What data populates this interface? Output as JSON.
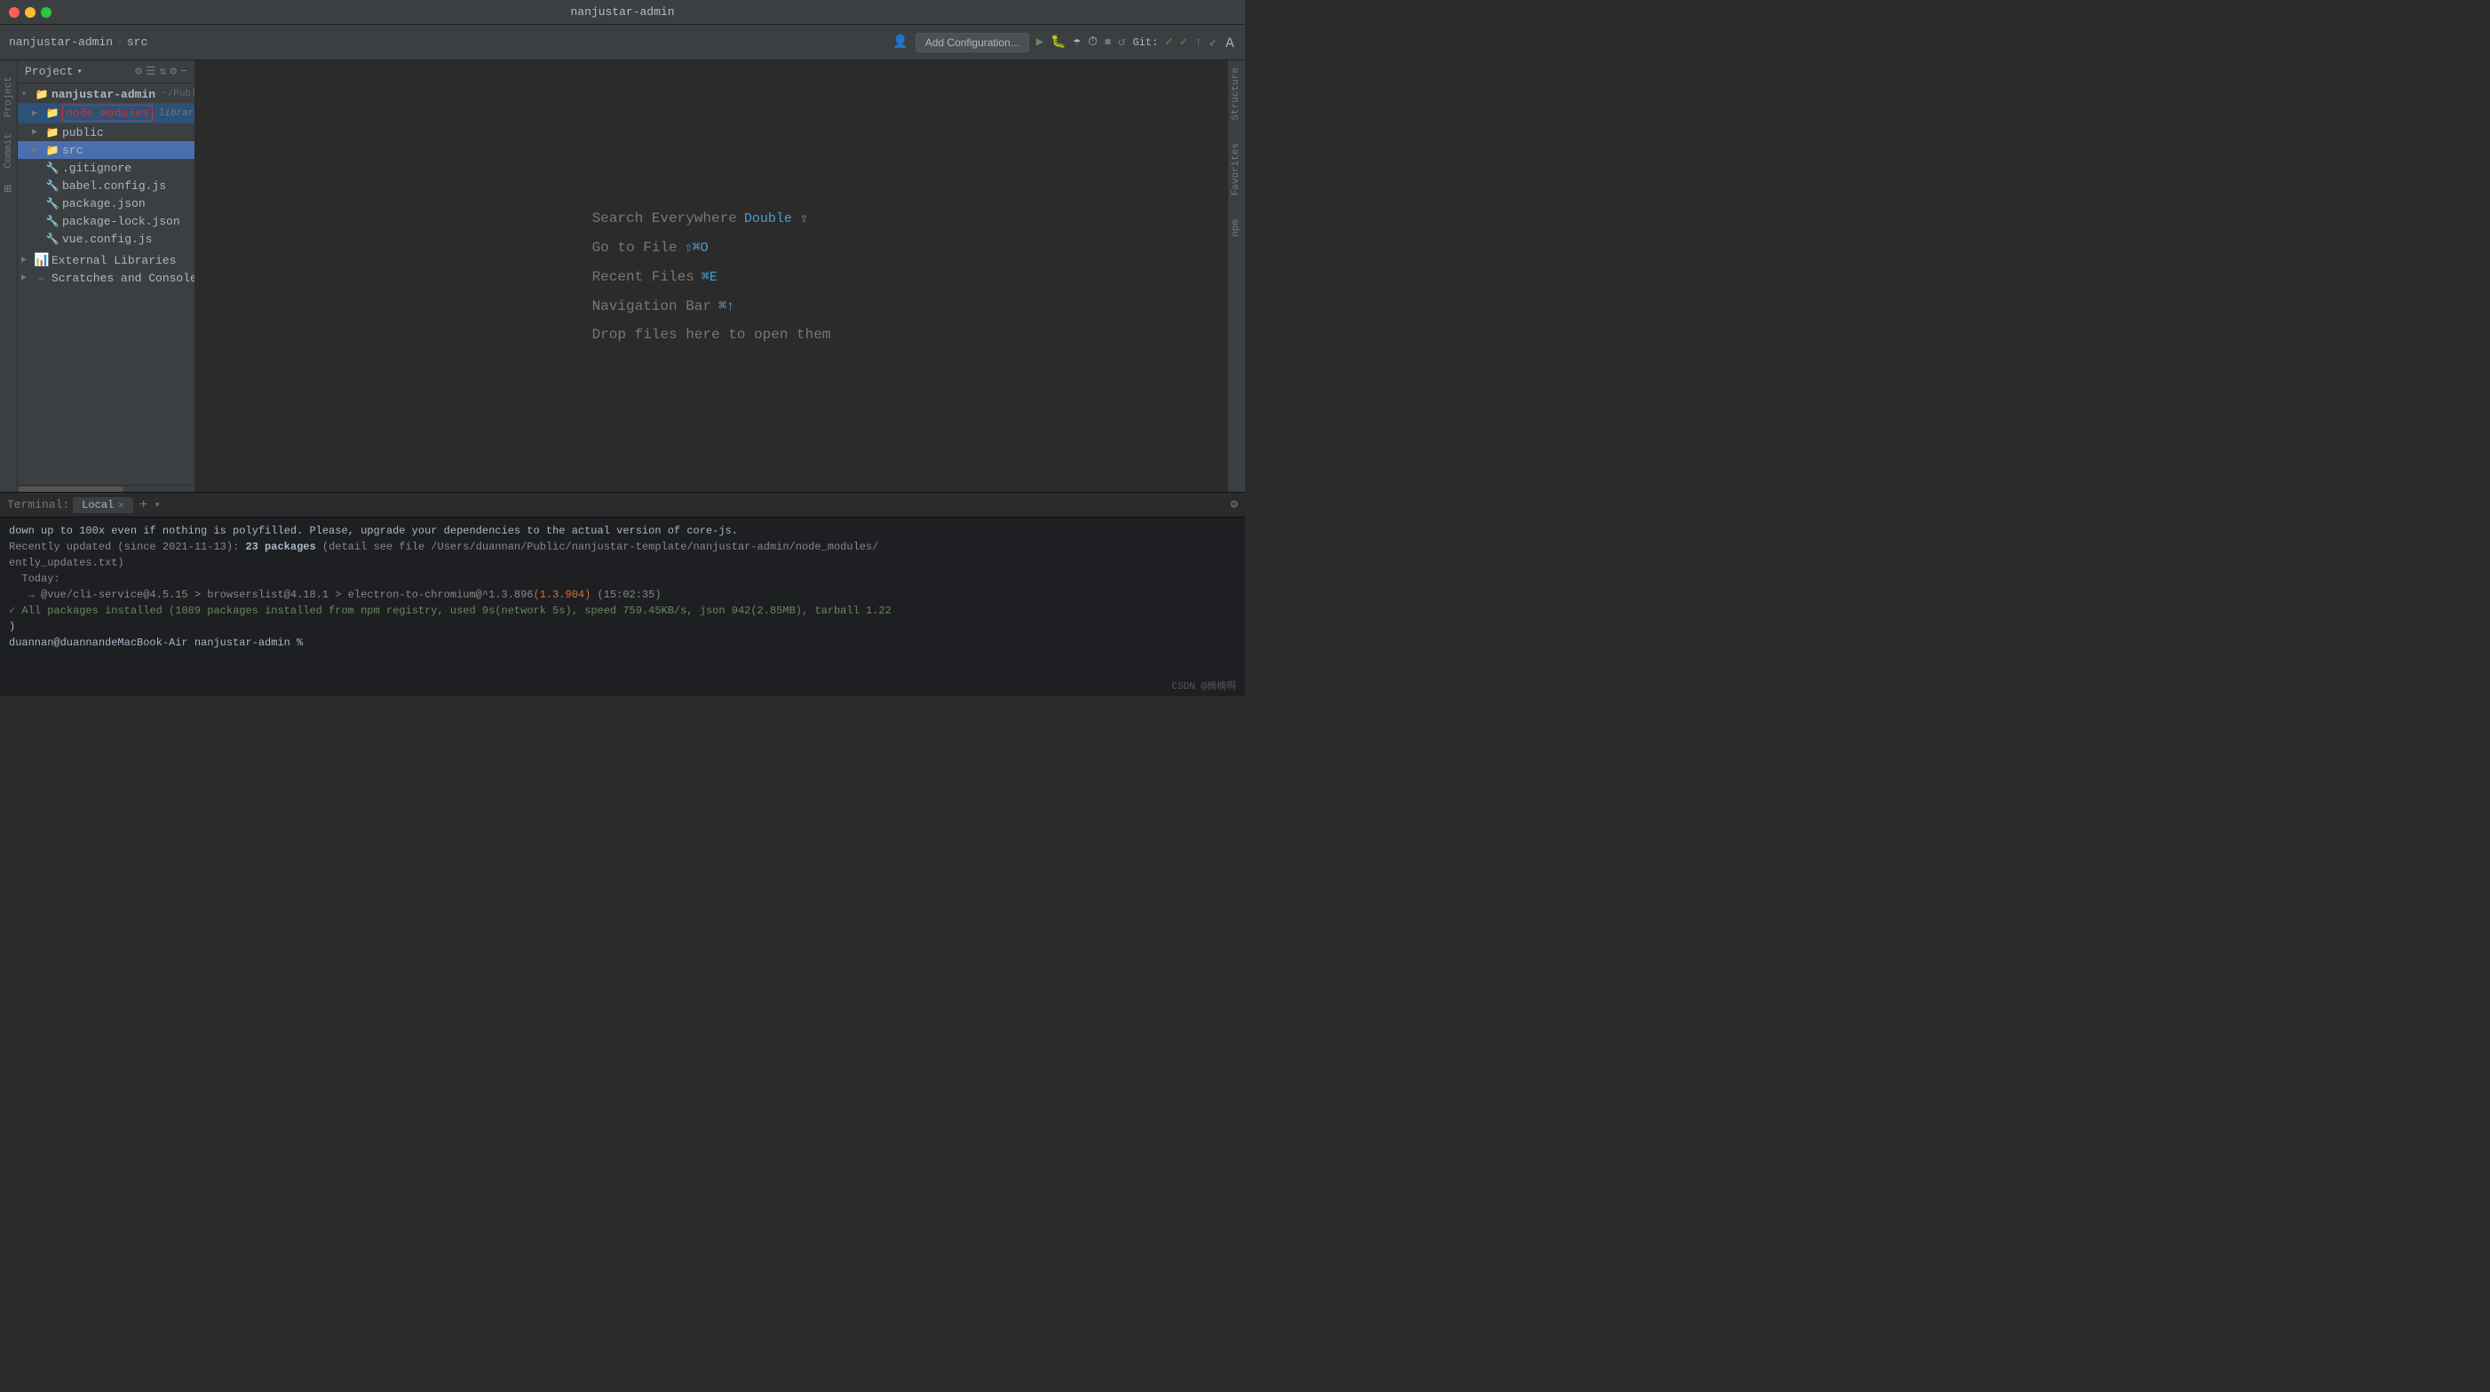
{
  "titleBar": {
    "title": "nanjustar-admin"
  },
  "toolbar": {
    "breadcrumb1": "nanjustar-admin",
    "breadcrumb2": "src",
    "addConfig": "Add Configuration...",
    "gitLabel": "Git:",
    "gitCheck1": "✓",
    "gitCheck2": "✓"
  },
  "sidebar": {
    "projectLabel": "Project",
    "chevron": "▾",
    "root": {
      "name": "nanjustar-admin",
      "path": "~/Public/nanjustar-template/nanj"
    },
    "items": [
      {
        "id": "node_modules",
        "label": "node_modules",
        "badge": "library root",
        "type": "folder",
        "indent": 1,
        "selected": true,
        "boxed": true
      },
      {
        "id": "public",
        "label": "public",
        "type": "folder",
        "indent": 1
      },
      {
        "id": "src",
        "label": "src",
        "type": "folder",
        "indent": 1,
        "highlighted": true
      },
      {
        "id": "gitignore",
        "label": ".gitignore",
        "type": "file",
        "indent": 1
      },
      {
        "id": "babel",
        "label": "babel.config.js",
        "type": "file-js",
        "indent": 1
      },
      {
        "id": "package",
        "label": "package.json",
        "type": "file-json",
        "indent": 1
      },
      {
        "id": "packagelock",
        "label": "package-lock.json",
        "type": "file-json",
        "indent": 1
      },
      {
        "id": "vue",
        "label": "vue.config.js",
        "type": "file-js",
        "indent": 1
      }
    ],
    "sections": [
      {
        "id": "external",
        "label": "External Libraries",
        "icon": "bars"
      },
      {
        "id": "scratches",
        "label": "Scratches and Consoles",
        "icon": "scratch"
      }
    ]
  },
  "editor": {
    "hints": [
      {
        "label": "Search Everywhere",
        "shortcut": "Double ⇧",
        "id": "search"
      },
      {
        "label": "Go to File",
        "shortcut": "⇧⌘O",
        "id": "goto-file"
      },
      {
        "label": "Recent Files",
        "shortcut": "⌘E",
        "id": "recent"
      },
      {
        "label": "Navigation Bar",
        "shortcut": "⌘↑",
        "id": "nav-bar"
      },
      {
        "label": "Drop files here to open them",
        "shortcut": "",
        "id": "drop"
      }
    ]
  },
  "terminal": {
    "label": "Terminal:",
    "tabs": [
      {
        "id": "local",
        "label": "Local"
      }
    ],
    "addLabel": "+",
    "chevron": "▾",
    "lines": [
      {
        "id": 1,
        "text": "down up to 100x even if nothing is polyfilled. Please, upgrade your dependencies to the actual version of core-js.",
        "color": "white"
      },
      {
        "id": 2,
        "text": "Recently updated (since 2021-11-13): 23 packages (detail see file /Users/duannan/Public/nanjustar-template/nanjustar-admin/node_modules/",
        "color": "gray"
      },
      {
        "id": 3,
        "text": "ently_updates.txt)",
        "color": "gray"
      },
      {
        "id": 4,
        "text": "  Today:",
        "color": "gray"
      },
      {
        "id": 5,
        "text": "   → @vue/cli-service@4.5.15 > browserslist@4.18.1 > electron-to-chromium@^1.3.896(1.3.904)  (15:02:35)",
        "color": "mixed"
      },
      {
        "id": 6,
        "text": "✓ All packages installed (1089 packages installed from npm registry, used 9s(network 5s), speed 759.45KB/s, json 942(2.85MB), tarball 1.22",
        "color": "green"
      },
      {
        "id": 7,
        "text": ")",
        "color": "white"
      },
      {
        "id": 8,
        "text": "duannan@duannandeMacBook-Air nanjustar-admin % ",
        "color": "prompt"
      }
    ]
  },
  "watermark": {
    "text": "CSDN @楠楠啊"
  }
}
